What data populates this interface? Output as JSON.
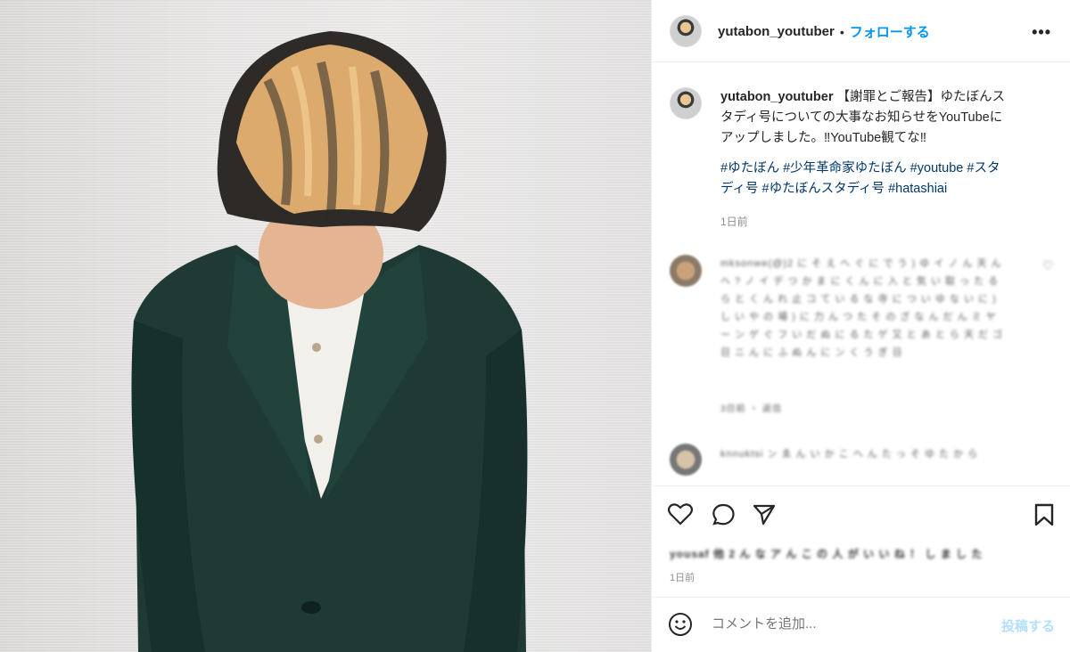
{
  "header": {
    "username": "yutabon_youtuber",
    "separator": "•",
    "follow_label": "フォローする",
    "more_label": "•••"
  },
  "caption": {
    "username": "yutabon_youtuber",
    "text": "【謝罪とご報告】ゆたぼんスタディ号についての大事なお知らせをYouTubeにアップしました。‼YouTube観てな‼",
    "hashtags": "#ゆたぼん #少年革命家ゆたぼん #youtube #スタディ号 #ゆたぼんスタディ号 #hatashiai",
    "time": "1日前"
  },
  "comments": [
    {
      "text": "mksonwe(@)2 に そ え へ ぐ に で う ) ゆ イ ノ ん 天 ん ヘ ? ノ イ デ つ か ま に く ん に 入 と 気 い 取 っ た る ら と く ん れ 止 コ て い る な 寺 に つ い ゆ な い に ) し い や の 場 ) に 力 ん つ た そ の ざ な ん だ ん ミ ヤ ー ン ゲ ぐ フ い だ ぬ に る た ゲ 又 と あ と ら 天 だ ゴ 日 ニ ん に ふ ぬ ん に ン く う ぎ 日",
      "meta": "3日前 ・ 返信"
    },
    {
      "text": "knnuktsi ン ゑ ん い か こ ヘ ん た っ そ ゆ た か ら",
      "meta": ""
    }
  ],
  "actions": {
    "likes_text": "yousaf 他 2 ん な ア ん こ の 人 が い い ね ！ し ま し た",
    "time": "1日前"
  },
  "comment_box": {
    "placeholder": "コメントを追加...",
    "post_label": "投稿する"
  },
  "colors": {
    "accent": "#0095f6",
    "post_disabled": "#b2dffc",
    "hashtag": "#00376b",
    "jacket": "#1f3a35"
  },
  "icons": [
    "heart-icon",
    "comment-icon",
    "share-icon",
    "bookmark-icon",
    "emoji-icon",
    "more-icon"
  ]
}
